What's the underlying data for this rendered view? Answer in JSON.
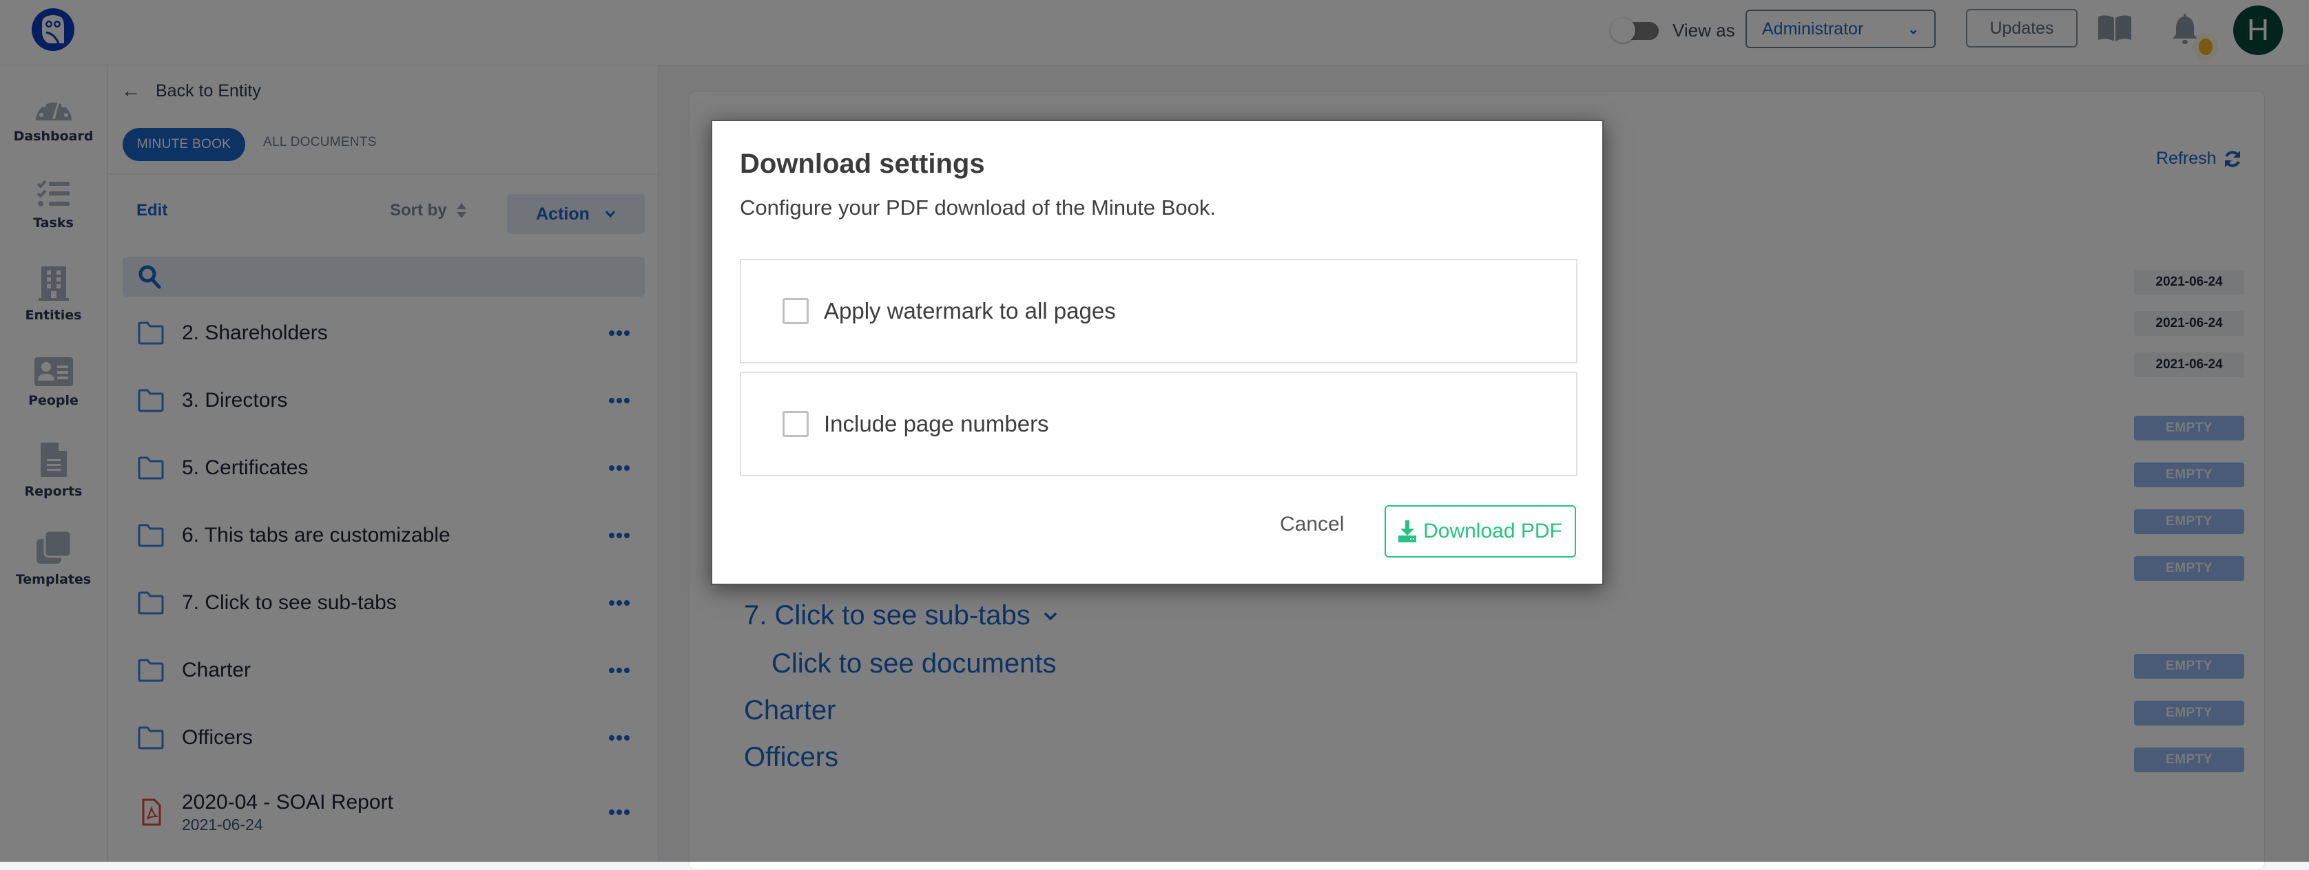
{
  "topbar": {
    "view_as_label": "View as",
    "view_as_toggle_on": false,
    "role_select_value": "Administrator",
    "updates_label": "Updates",
    "avatar_initial": "H",
    "notification_dot_color": "#f0b429"
  },
  "nav": {
    "items": [
      {
        "label": "Dashboard",
        "icon": "dashboard-gauge-icon"
      },
      {
        "label": "Tasks",
        "icon": "tasks-checklist-icon"
      },
      {
        "label": "Entities",
        "icon": "building-icon"
      },
      {
        "label": "People",
        "icon": "id-card-icon"
      },
      {
        "label": "Reports",
        "icon": "document-icon"
      },
      {
        "label": "Templates",
        "icon": "copy-icon"
      }
    ]
  },
  "left_panel": {
    "back_label": "Back to Entity",
    "tabs": [
      {
        "label": "MINUTE BOOK",
        "active": true
      },
      {
        "label": "ALL DOCUMENTS",
        "active": false
      }
    ],
    "toolbar": {
      "edit_label": "Edit",
      "sort_label": "Sort by",
      "action_label": "Action"
    },
    "search": {
      "value": "",
      "placeholder": ""
    },
    "items": [
      {
        "type": "folder",
        "name": "2. Shareholders"
      },
      {
        "type": "folder",
        "name": "3. Directors"
      },
      {
        "type": "folder",
        "name": "5. Certificates"
      },
      {
        "type": "folder",
        "name": "6. This tabs are customizable"
      },
      {
        "type": "folder",
        "name": "7. Click to see sub-tabs"
      },
      {
        "type": "folder",
        "name": "Charter"
      },
      {
        "type": "folder",
        "name": "Officers"
      },
      {
        "type": "pdf",
        "name": "2020-04 - SOAI Report",
        "date": "2021-06-24"
      }
    ]
  },
  "main_panel": {
    "refresh_label": "Refresh",
    "date_badges": [
      "2021-06-24",
      "2021-06-24",
      "2021-06-24"
    ],
    "empty_badge_label": "EMPTY",
    "tree": [
      {
        "label": "7. Click to see sub-tabs",
        "expanded": true
      },
      {
        "label": "Click to see documents"
      },
      {
        "label": "Charter"
      },
      {
        "label": "Officers"
      }
    ]
  },
  "modal": {
    "title": "Download settings",
    "subtitle": "Configure your PDF download of the Minute Book.",
    "options": [
      {
        "label": "Apply watermark to all pages",
        "checked": false
      },
      {
        "label": "Include page numbers",
        "checked": false
      }
    ],
    "cancel_label": "Cancel",
    "download_label": "Download PDF",
    "accent_color": "#26c281"
  },
  "colors": {
    "brand": "#0a3dc4",
    "link": "#1b64c8",
    "avatar_bg": "#06463a"
  }
}
